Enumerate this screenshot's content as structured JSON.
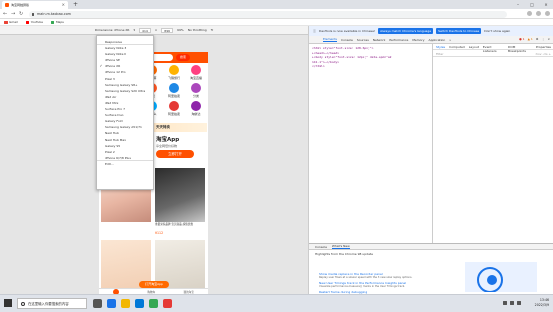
{
  "browser": {
    "tab_title": "淘宝网触屏版",
    "url": "main.m.taobao.com",
    "bookmarks": [
      {
        "label": "Gmail",
        "color": "#ea4335"
      },
      {
        "label": "YouTube",
        "color": "#ff0000"
      },
      {
        "label": "Maps",
        "color": "#34a853"
      }
    ]
  },
  "device_toolbar": {
    "device": "Dimensions: iPhone XR",
    "width": "414",
    "height": "896",
    "zoom": "99%",
    "throttle": "No throttling"
  },
  "dropdown": {
    "options": [
      {
        "label": "Responsive",
        "checked": false,
        "sep": true
      },
      {
        "label": "Galaxy Note 3",
        "checked": false
      },
      {
        "label": "Galaxy Note II",
        "checked": false
      },
      {
        "label": "iPhone SE",
        "checked": false
      },
      {
        "label": "iPhone XR",
        "checked": true
      },
      {
        "label": "iPhone 12 Pro",
        "checked": false
      },
      {
        "label": "Pixel 3",
        "checked": false
      },
      {
        "label": "Samsung Galaxy S8+",
        "checked": false
      },
      {
        "label": "Samsung Galaxy S20 Ultra",
        "checked": false
      },
      {
        "label": "iPad Air",
        "checked": false
      },
      {
        "label": "iPad Mini",
        "checked": false
      },
      {
        "label": "Surface Pro 7",
        "checked": false
      },
      {
        "label": "Surface Duo",
        "checked": false
      },
      {
        "label": "Galaxy Fold",
        "checked": false
      },
      {
        "label": "Samsung Galaxy A51/71",
        "checked": false
      },
      {
        "label": "Nest Hub",
        "checked": false
      },
      {
        "label": "Nest Hub Max",
        "checked": false
      },
      {
        "label": "Galaxy S5",
        "checked": false
      },
      {
        "label": "Pixel 2",
        "checked": false
      },
      {
        "label": "iPhone 6/7/8 Plus",
        "checked": false,
        "sep": true
      },
      {
        "label": "Edit...",
        "checked": false
      }
    ]
  },
  "phone": {
    "header_button": "搜索",
    "grid": [
      {
        "label": "天猫",
        "color": "#ff3b30"
      },
      {
        "label": "聚划算",
        "color": "#ff6a00"
      },
      {
        "label": "飞猪旅行",
        "color": "#ffb300"
      },
      {
        "label": "淘宝直播",
        "color": "#ff4081"
      },
      {
        "label": "领金币",
        "color": "#ffa000"
      },
      {
        "label": "拍卖",
        "color": "#ff5722"
      },
      {
        "label": "阿里拍卖",
        "color": "#1e88e5"
      },
      {
        "label": "分类",
        "color": "#ab47bc"
      },
      {
        "label": "充值",
        "color": "#43a047"
      },
      {
        "label": "饿了么",
        "color": "#00aaff"
      },
      {
        "label": "阿里拍卖",
        "color": "#e53935"
      },
      {
        "label": "淘鲜达",
        "color": "#8e24aa"
      }
    ],
    "promo_top": "天天特卖",
    "promo_big": "淘宝App",
    "promo_sub": "享全网低价好物",
    "promo_button": "立即打开",
    "product_text": "重量米家品牌 宝贝商品 超值优惠",
    "product_price": "¥112",
    "app_pill": "打开淘宝App",
    "nav_home": "首页",
    "nav_cart": "购物车",
    "nav_me": "我的淘宝"
  },
  "devtools": {
    "infobar_text": "DevTools is now available in Chinese!",
    "infobar_btn1": "Always match Chrome's language",
    "infobar_btn2": "Switch DevTools to Chinese",
    "infobar_btn3": "Don't show again",
    "tabs": [
      "Elements",
      "Console",
      "Sources",
      "Network",
      "Performance",
      "Memory",
      "Application",
      "»"
    ],
    "badge_errors": "1",
    "badge_warnings": "1",
    "code_lines": [
      "<html style=\"font-size: 128.6px;\">",
      "▸<head>…</head>",
      "▸<body style=\"font-size: 12px;\" data-spm=\"a2",
      "  141.1\">…</body>",
      "</html>"
    ],
    "styles_tabs": [
      "Styles",
      "Computed",
      "Layout",
      "Event Listeners",
      "DOM Breakpoints",
      "Properties"
    ],
    "filter_placeholder": "Filter",
    "filter_right": ":hov .cls +",
    "drawer_tabs": [
      "Console",
      "What's New"
    ],
    "drawer_headline": "Highlights from the Chrome 98 update",
    "news": [
      {
        "title": "Show media replace in the Recorder panel",
        "desc": "Replay user flows at a slower speed with the 3 new slow replay options."
      },
      {
        "title": "New User Timings track in the Performance Insights panel",
        "desc": "Visualize performance.measure() marks in the User Timings track."
      },
      {
        "title": "Restart frame during debugging",
        "desc": ""
      }
    ]
  },
  "taskbar": {
    "search_placeholder": "在这里输入你要搜索的内容",
    "apps": [
      {
        "name": "task-view",
        "color": "#555555"
      },
      {
        "name": "edge",
        "color": "#1a73e8"
      },
      {
        "name": "explorer",
        "color": "#f2b600"
      },
      {
        "name": "store",
        "color": "#0078d7"
      },
      {
        "name": "chrome",
        "color": "#34a853"
      },
      {
        "name": "app",
        "color": "#e53935"
      }
    ],
    "time": "13:46",
    "date": "2022/3/9"
  }
}
